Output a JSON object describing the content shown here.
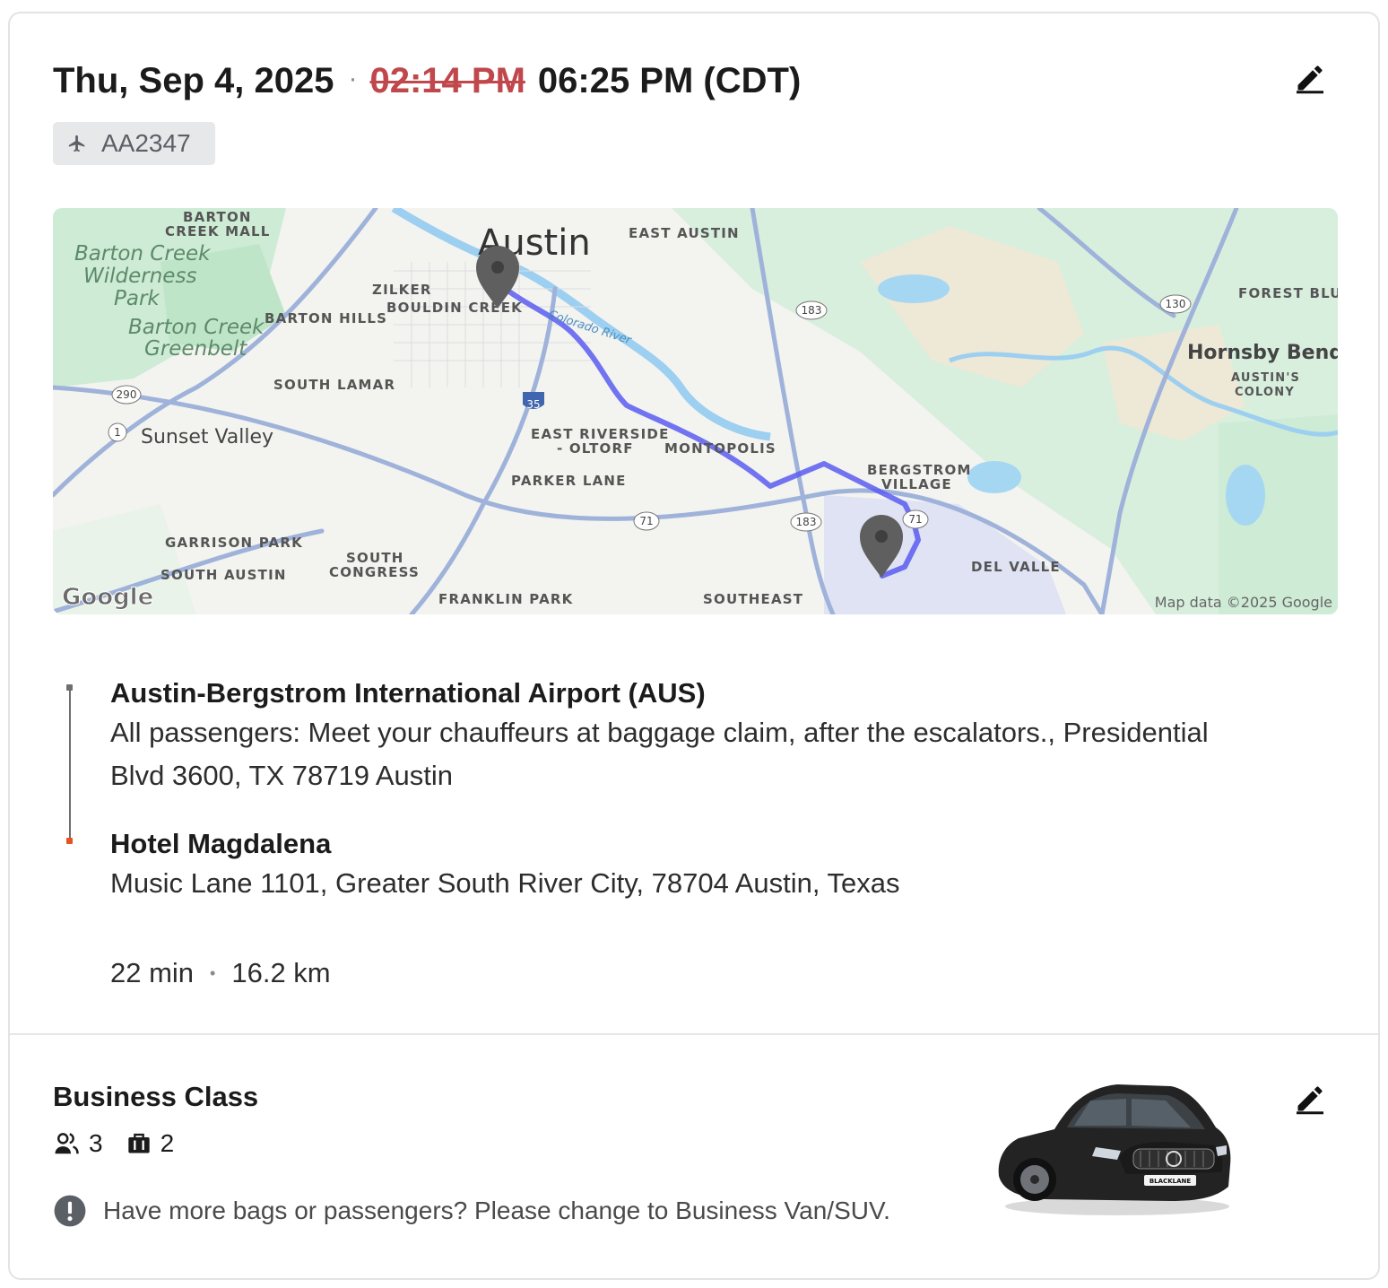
{
  "header": {
    "date": "Thu, Sep 4, 2025",
    "separator": "·",
    "original_time": "02:14 PM",
    "new_time": "06:25 PM (CDT)",
    "edit_icon": "pencil-icon"
  },
  "flight": {
    "number": "AA2347",
    "icon": "airplane-icon"
  },
  "map": {
    "labels": {
      "barton_creek_mall_1": "BARTON",
      "barton_creek_mall_2": "CREEK MALL",
      "barton_creek_wild_1": "Barton Creek",
      "barton_creek_wild_2": "Wilderness",
      "barton_creek_wild_3": "Park",
      "austin": "Austin",
      "east_austin": "EAST AUSTIN",
      "zilker": "ZILKER",
      "bouldin_creek": "BOULDIN CREEK",
      "barton_hills": "BARTON HILLS",
      "greenbelt_1": "Barton Creek",
      "greenbelt_2": "Greenbelt",
      "colorado_river": "Colorado River",
      "forest_bluff": "FOREST BLU",
      "hornsby_bend": "Hornsby Bend",
      "austins_colony_1": "AUSTIN'S",
      "austins_colony_2": "COLONY",
      "south_lamar": "SOUTH LAMAR",
      "sunset_valley": "Sunset Valley",
      "east_riverside_1": "EAST RIVERSIDE",
      "east_riverside_2": "- OLTORF",
      "montopolis": "MONTOPOLIS",
      "parker_lane": "PARKER LANE",
      "bergstrom_1": "BERGSTROM",
      "bergstrom_2": "VILLAGE",
      "garrison_park": "GARRISON PARK",
      "south_congress_1": "SOUTH",
      "south_congress_2": "CONGRESS",
      "south_austin": "SOUTH AUSTIN",
      "del_valle": "DEL VALLE",
      "franklin_park": "FRANKLIN PARK",
      "southeast": "SOUTHEAST",
      "shield_290": "290",
      "shield_1": "1",
      "shield_35": "35",
      "shield_183a": "183",
      "shield_183b": "183",
      "shield_130": "130",
      "shield_71a": "71",
      "shield_71b": "71",
      "google_logo": "Google",
      "attribution": "Map data ©2025 Google"
    },
    "route_color": "#5b5cf0",
    "pin_color": "#5f5f5f"
  },
  "route": {
    "pickup": {
      "name": "Austin-Bergstrom International Airport (AUS)",
      "address_line1": "All passengers: Meet your chauffeurs at baggage claim, after the escalators., Presidential",
      "address_line2": "Blvd 3600, TX 78719 Austin"
    },
    "dropoff": {
      "name": "Hotel Magdalena",
      "address": "Music Lane 1101, Greater South River City, 78704 Austin, Texas"
    },
    "duration": "22 min",
    "separator": "•",
    "distance": "16.2 km"
  },
  "vehicle": {
    "class": "Business Class",
    "passengers": "3",
    "bags": "2",
    "passenger_icon": "people-icon",
    "bag_icon": "luggage-icon",
    "note": "Have more bags or passengers? Please change to Business Van/SUV.",
    "note_icon": "info-icon",
    "plate_text": "BLACKLANE"
  },
  "colors": {
    "struck_time": "#c0474b",
    "dropoff_marker": "#e5531f",
    "badge_bg": "#e7e8ea"
  }
}
